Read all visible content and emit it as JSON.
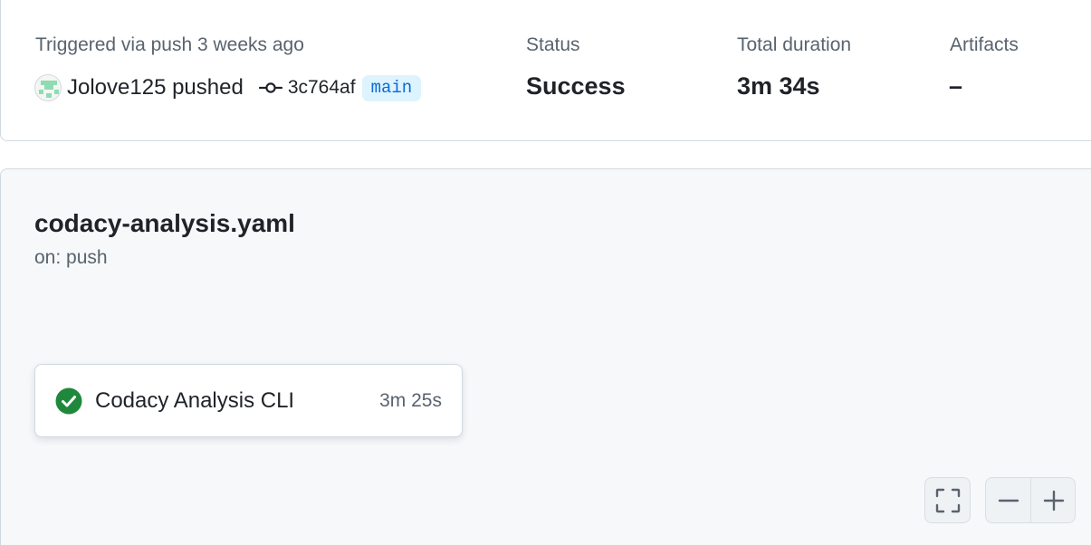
{
  "summary": {
    "trigger_label": "Triggered via push 3 weeks ago",
    "actor": "Jolove125 pushed",
    "commit_sha": "3c764af",
    "branch": "main",
    "status_label": "Status",
    "status_value": "Success",
    "duration_label": "Total duration",
    "duration_value": "3m 34s",
    "artifacts_label": "Artifacts",
    "artifacts_value": "–"
  },
  "workflow": {
    "file": "codacy-analysis.yaml",
    "trigger": "on: push",
    "jobs": [
      {
        "name": "Codacy Analysis CLI",
        "duration": "3m 25s",
        "status": "success"
      }
    ]
  },
  "icons": {
    "avatar": "user-avatar-identicon",
    "commit": "git-commit-icon",
    "success": "check-circle-fill-icon",
    "fullscreen": "screen-full-icon",
    "zoom_out": "dash-icon",
    "zoom_in": "plus-icon"
  },
  "colors": {
    "success": "#1f883d",
    "branch_text": "#0969da",
    "branch_bg": "#ddf4ff",
    "identicon": "#8fdcb1"
  }
}
